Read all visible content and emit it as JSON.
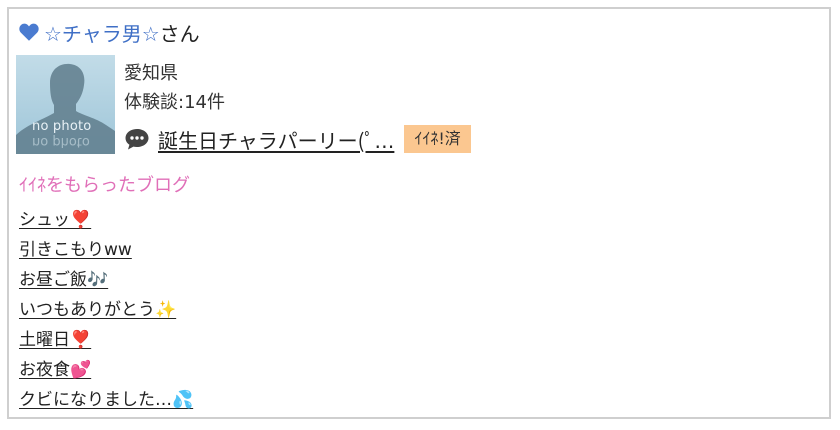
{
  "user": {
    "name": "☆チャラ男☆",
    "suffix": "さん",
    "heart_color": "#4a7bd0"
  },
  "avatar": {
    "caption": "no photo"
  },
  "profile": {
    "location": "愛知県",
    "experience": "体験談:14件"
  },
  "post": {
    "title": "誕生日チャラパーリー(ﾟ…",
    "like_badge": "ｲｲﾈ!済"
  },
  "section": {
    "title": "ｲｲﾈをもらったブログ"
  },
  "blogs": [
    "シュッ❣️",
    "引きこもりww",
    "お昼ご飯🎶",
    "いつもありがとう✨",
    "土曜日❣️",
    "お夜食💕",
    "クビになりました…💦"
  ],
  "colors": {
    "accent_blue": "#3f6fc6",
    "accent_pink": "#e06fb8",
    "badge_orange": "#fbc790",
    "border": "#cfcfcf"
  }
}
